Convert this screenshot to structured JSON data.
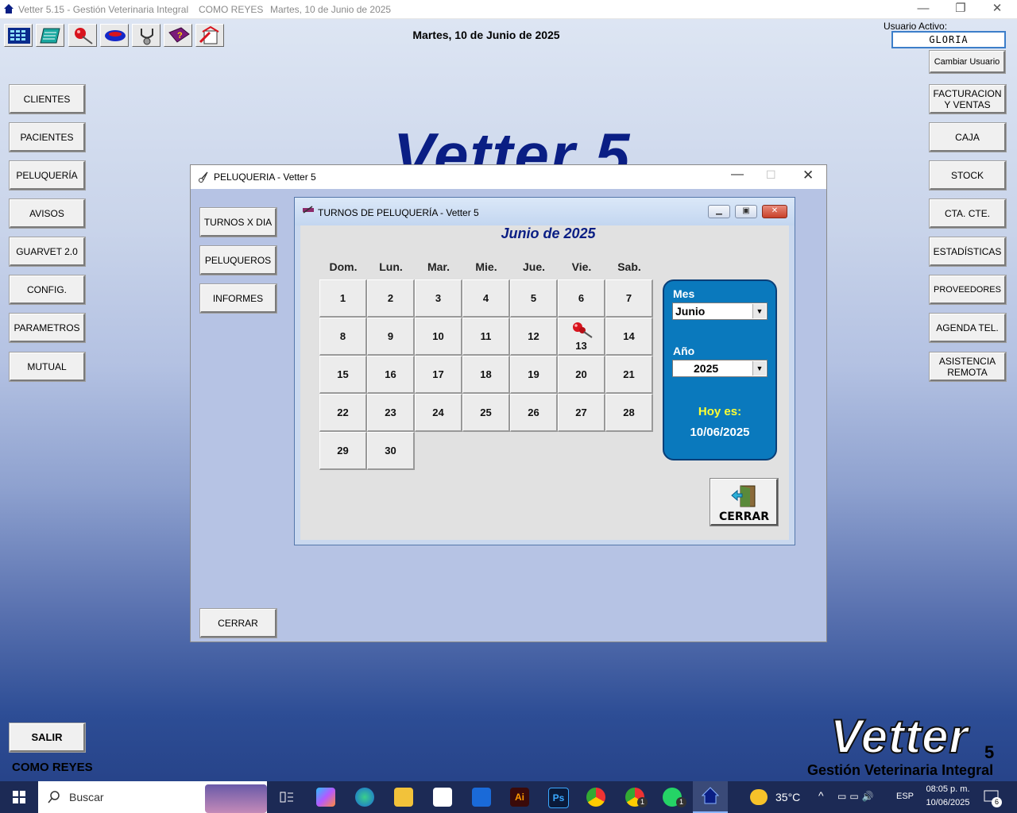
{
  "titlebar": {
    "app": "Vetter 5.15 - Gestión Veterinaria Integral",
    "branch": "COMO REYES",
    "date": "Martes, 10 de Junio de 2025"
  },
  "header": {
    "date": "Martes, 10 de Junio de 2025",
    "user_label": "Usuario Activo:",
    "user_name": "GLORIA",
    "change_user": "Cambiar Usuario"
  },
  "left_menu": [
    "CLIENTES",
    "PACIENTES",
    "PELUQUERÍA",
    "AVISOS",
    "GUARVET 2.0",
    "CONFIG.",
    "PARAMETROS",
    "MUTUAL"
  ],
  "right_menu": [
    "FACTURACION\nY VENTAS",
    "CAJA",
    "STOCK",
    "CTA. CTE.",
    "ESTADÍSTICAS",
    "PROVEEDORES",
    "AGENDA TEL.",
    "ASISTENCIA\nREMOTA"
  ],
  "logo": {
    "big": "Vetter 5",
    "small": "Vetter",
    "version": "5",
    "tagline": "Gestión Veterinaria Integral"
  },
  "salir": "SALIR",
  "branch_footer": "COMO REYES",
  "peluqueria_dialog": {
    "title": "PELUQUERIA - Vetter 5",
    "buttons": [
      "TURNOS X DIA",
      "PELUQUEROS",
      "INFORMES"
    ],
    "close": "CERRAR"
  },
  "turnos_dialog": {
    "title": "TURNOS DE PELUQUERÍA - Vetter 5",
    "month_title": "Junio de 2025",
    "weekdays": [
      "Dom.",
      "Lun.",
      "Mar.",
      "Mie.",
      "Jue.",
      "Vie.",
      "Sab."
    ],
    "days": [
      "1",
      "2",
      "3",
      "4",
      "5",
      "6",
      "7",
      "8",
      "9",
      "10",
      "11",
      "12",
      "13",
      "14",
      "15",
      "16",
      "17",
      "18",
      "19",
      "20",
      "21",
      "22",
      "23",
      "24",
      "25",
      "26",
      "27",
      "28",
      "29",
      "30"
    ],
    "first_weekday_index": 0,
    "marked_day": "13",
    "mes_label": "Mes",
    "mes_value": "Junio",
    "anio_label": "Año",
    "anio_value": "2025",
    "hoy_label": "Hoy es:",
    "hoy_value": "10/06/2025",
    "close": "CERRAR"
  },
  "taskbar": {
    "search": "Buscar",
    "temp": "35°C",
    "lang": "ESP",
    "time": "08:05 p. m.",
    "date": "10/06/2025",
    "notifications": "6",
    "whatsapp_badge": "1",
    "chrome_badge": "1"
  }
}
